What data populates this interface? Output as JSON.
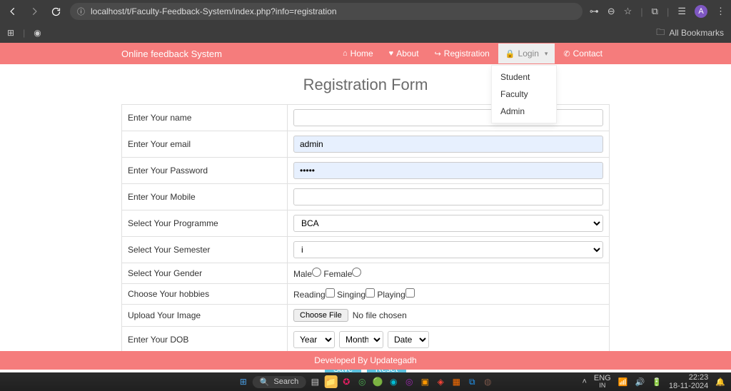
{
  "browser": {
    "url": "localhost/t/Faculty-Feedback-System/index.php?info=registration",
    "avatar_letter": "A",
    "all_bookmarks": "All Bookmarks"
  },
  "nav": {
    "brand": "Online feedback System",
    "home": "Home",
    "about": "About",
    "registration": "Registration",
    "login": "Login",
    "contact": "Contact",
    "dropdown": {
      "student": "Student",
      "faculty": "Faculty",
      "admin": "Admin"
    }
  },
  "page": {
    "title": "Registration Form"
  },
  "form": {
    "labels": {
      "name": "Enter Your name",
      "email": "Enter Your email",
      "password": "Enter Your Password",
      "mobile": "Enter Your Mobile",
      "programme": "Select Your Programme",
      "semester": "Select Your Semester",
      "gender": "Select Your Gender",
      "hobbies": "Choose Your hobbies",
      "image": "Upload Your Image",
      "dob": "Enter Your DOB"
    },
    "values": {
      "name": "",
      "email": "admin",
      "password": "•••••",
      "mobile": "",
      "programme": "BCA",
      "semester": "i",
      "dob_year": "Year",
      "dob_month": "Month",
      "dob_date": "Date"
    },
    "gender": {
      "male": "Male",
      "female": "Female"
    },
    "hobbies": {
      "reading": "Reading",
      "singing": "Singing",
      "playing": "Playing"
    },
    "file": {
      "button": "Choose File",
      "status": "No file chosen"
    },
    "actions": {
      "save": "Save",
      "reset": "Reset"
    }
  },
  "footer": {
    "text": "Developed By Updategadh"
  },
  "taskbar": {
    "search_placeholder": "Search",
    "lang": "ENG",
    "region": "IN",
    "time": "22:23",
    "date": "18-11-2024"
  }
}
